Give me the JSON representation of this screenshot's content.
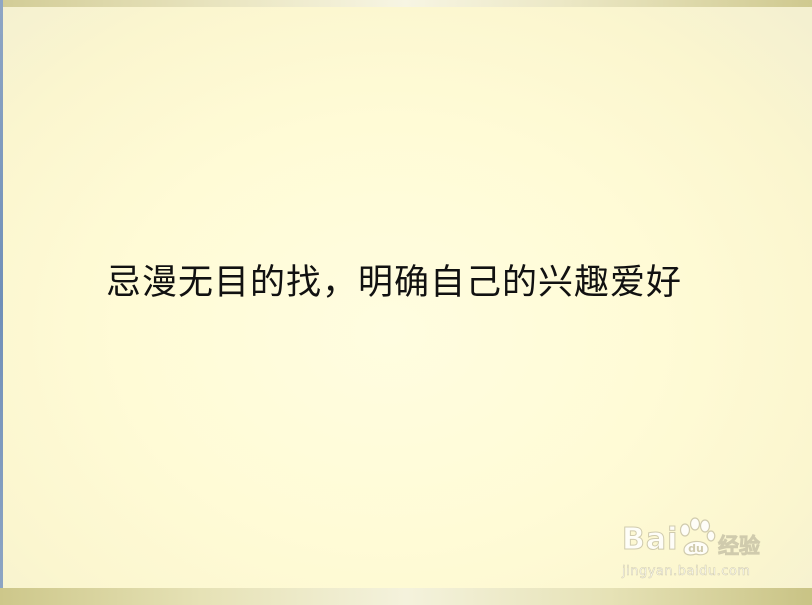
{
  "slide": {
    "headline": "忌漫无目的找，明确自己的兴趣爱好"
  },
  "watermark": {
    "logo": "Bai",
    "logo_tail": "经验",
    "url": "jingyan.baidu.com"
  },
  "colors": {
    "background": "#fffbd6",
    "top_bar": "#ebe7c4",
    "bottom_bar": "#e6e2b6",
    "left_edge": "#6f8fb8",
    "text": "#111111"
  },
  "icons": [
    "paw-icon"
  ]
}
